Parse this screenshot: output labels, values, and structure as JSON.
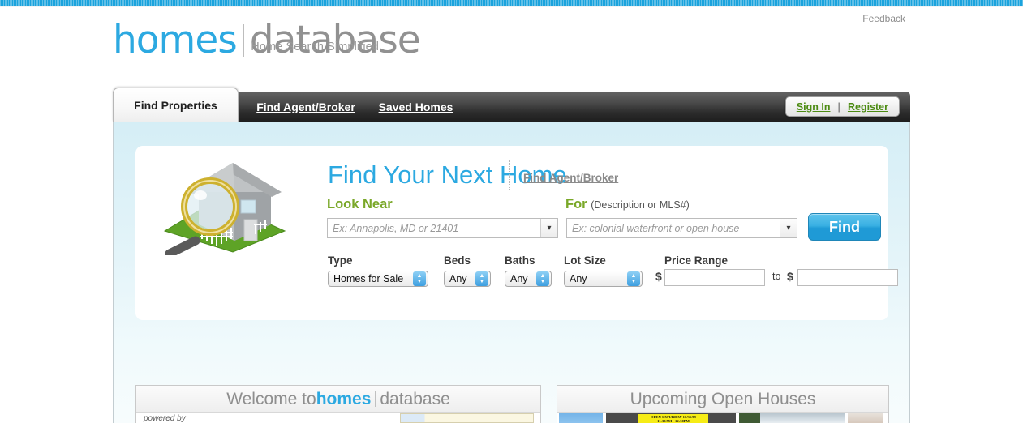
{
  "topbar": {
    "feedback_label": "Feedback"
  },
  "brand": {
    "name_blue": "homes",
    "name_grey": "database",
    "tagline": "Home Search Simplified"
  },
  "nav": {
    "tabs": [
      {
        "label": "Find Properties",
        "active": true
      },
      {
        "label": "Find Agent/Broker",
        "active": false
      },
      {
        "label": "Saved Homes",
        "active": false
      }
    ],
    "auth": {
      "sign_in_label": "Sign In",
      "separator": "|",
      "register_label": "Register"
    }
  },
  "search": {
    "headline": "Find Your Next Home",
    "agent_link_label": "Find Agent/Broker",
    "look_near": {
      "label": "Look Near",
      "value": "",
      "placeholder": "Ex: Annapolis, MD or 21401",
      "dropdown_icon": "chevron-down-icon"
    },
    "for": {
      "label": "For",
      "sublabel": "(Description or MLS#)",
      "value": "",
      "placeholder": "Ex: colonial waterfront or open house",
      "dropdown_icon": "chevron-down-icon"
    },
    "find_button_label": "Find",
    "house_art_alt": "house-with-magnifier-illustration",
    "filters": {
      "type": {
        "label": "Type",
        "value": "Homes for Sale"
      },
      "beds": {
        "label": "Beds",
        "value": "Any"
      },
      "baths": {
        "label": "Baths",
        "value": "Any"
      },
      "lot_size": {
        "label": "Lot Size",
        "value": "Any"
      },
      "price_range": {
        "label": "Price Range",
        "currency_symbol_min": "$",
        "min_value": "",
        "to_label": "to",
        "currency_symbol_max": "$",
        "max_value": ""
      }
    }
  },
  "panels": {
    "welcome": {
      "title_prefix": "Welcome to ",
      "title_blue": "homes",
      "title_grey": "database",
      "powered_by_label": "powered by"
    },
    "open_houses": {
      "title": "Upcoming Open Houses",
      "listings": [
        {
          "banner_line1": "",
          "banner_line2": ""
        },
        {
          "banner_line1": "OPEN SATURDAY 10/31/09",
          "banner_line2": "11:30AM - 12:30PM"
        },
        {
          "banner_line1": "",
          "banner_line2": ""
        },
        {
          "banner_line1": "",
          "banner_line2": ""
        }
      ]
    }
  },
  "colors": {
    "brand_blue": "#2ca9e1",
    "brand_grey": "#919191",
    "accent_green": "#7aa829",
    "link_green": "#4c8b12",
    "top_strip": "#1ba3dd"
  }
}
